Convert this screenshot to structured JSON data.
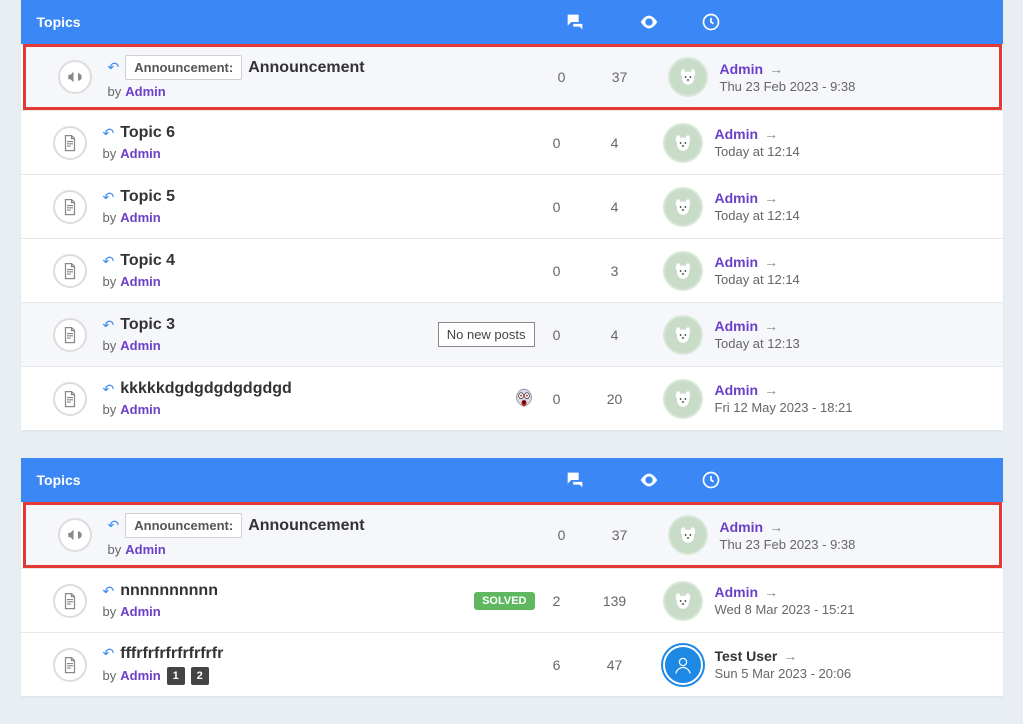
{
  "sections": [
    {
      "header": {
        "topics_label": "Topics"
      },
      "rows": [
        {
          "sticky": true,
          "highlight": true,
          "icon": "megaphone",
          "announce_label": "Announcement:",
          "title": "Announcement",
          "by": "by",
          "author": "Admin",
          "replies": "0",
          "views": "37",
          "last_user": "Admin",
          "last_time": "Thu 23 Feb 2023 - 9:38",
          "avatar": "dog"
        },
        {
          "sticky": false,
          "icon": "doc",
          "title": "Topic 6",
          "by": "by",
          "author": "Admin",
          "replies": "0",
          "views": "4",
          "last_user": "Admin",
          "last_time": "Today at 12:14",
          "avatar": "dog"
        },
        {
          "sticky": false,
          "icon": "doc",
          "title": "Topic 5",
          "by": "by",
          "author": "Admin",
          "replies": "0",
          "views": "4",
          "last_user": "Admin",
          "last_time": "Today at 12:14",
          "avatar": "dog"
        },
        {
          "sticky": false,
          "icon": "doc",
          "title": "Topic 4",
          "by": "by",
          "author": "Admin",
          "replies": "0",
          "views": "3",
          "last_user": "Admin",
          "last_time": "Today at 12:14",
          "avatar": "dog"
        },
        {
          "sticky": true,
          "icon": "doc",
          "title": "Topic 3",
          "by": "by",
          "author": "Admin",
          "tooltip": "No new posts",
          "replies": "0",
          "views": "4",
          "last_user": "Admin",
          "last_time": "Today at 12:13",
          "avatar": "dog"
        },
        {
          "sticky": false,
          "icon": "doc",
          "title": "kkkkkdgdgdgdgdgdgd",
          "by": "by",
          "author": "Admin",
          "emoji": true,
          "replies": "0",
          "views": "20",
          "last_user": "Admin",
          "last_time": "Fri 12 May 2023 - 18:21",
          "avatar": "dog"
        }
      ]
    },
    {
      "header": {
        "topics_label": "Topics"
      },
      "rows": [
        {
          "sticky": true,
          "highlight": true,
          "icon": "megaphone",
          "announce_label": "Announcement:",
          "title": "Announcement",
          "by": "by",
          "author": "Admin",
          "replies": "0",
          "views": "37",
          "last_user": "Admin",
          "last_time": "Thu 23 Feb 2023 - 9:38",
          "avatar": "dog"
        },
        {
          "sticky": false,
          "icon": "doc",
          "title": "nnnnnnnnnn",
          "by": "by",
          "author": "Admin",
          "solved": "SOLVED",
          "replies": "2",
          "views": "139",
          "last_user": "Admin",
          "last_time": "Wed 8 Mar 2023 - 15:21",
          "avatar": "dog"
        },
        {
          "sticky": false,
          "icon": "doc",
          "title": "fffrfrfrfrfrfrfrfr",
          "by": "by",
          "author": "Admin",
          "pages": [
            "1",
            "2"
          ],
          "replies": "6",
          "views": "47",
          "last_user": "Test User",
          "last_user_dark": true,
          "last_time": "Sun 5 Mar 2023 - 20:06",
          "avatar": "blue"
        }
      ]
    }
  ]
}
